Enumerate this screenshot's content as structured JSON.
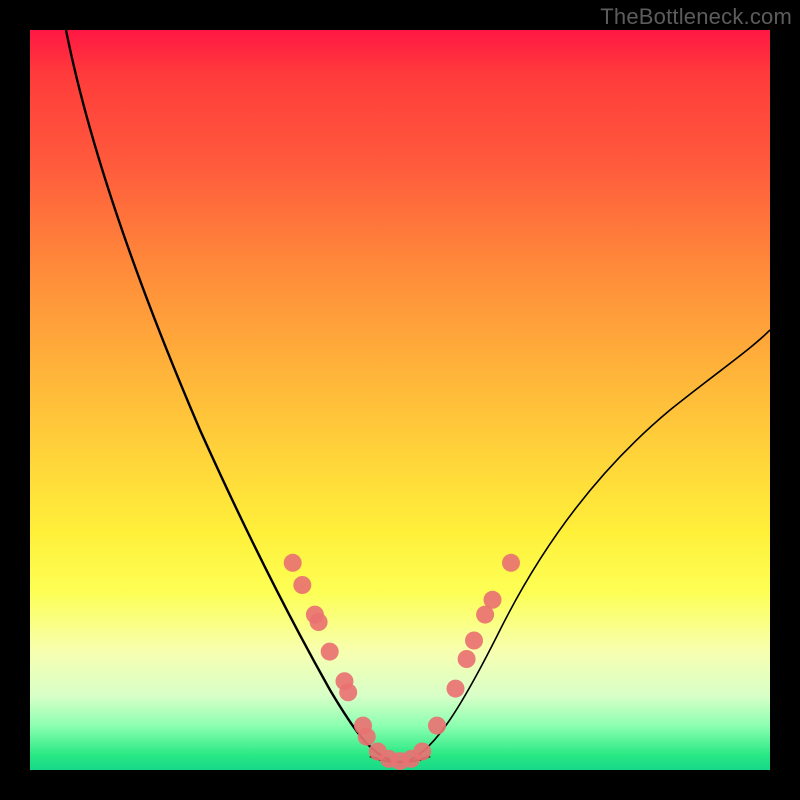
{
  "watermark": "TheBottleneck.com",
  "chart_data": {
    "type": "line",
    "title": "",
    "xlabel": "",
    "ylabel": "",
    "xlim": [
      0,
      100
    ],
    "ylim": [
      0,
      100
    ],
    "grid": false,
    "legend": false,
    "background_gradient": {
      "top": "#ff1744",
      "mid": "#ffd53a",
      "bottom": "#17d888"
    },
    "series": [
      {
        "name": "left-branch",
        "x": [
          4,
          8,
          12,
          16,
          20,
          24,
          28,
          32,
          34,
          36,
          38,
          40,
          42,
          44,
          46,
          48
        ],
        "values": [
          100,
          93,
          85,
          76,
          67,
          58,
          49,
          39,
          34,
          29,
          24,
          19,
          14,
          9,
          5,
          2
        ]
      },
      {
        "name": "right-branch",
        "x": [
          52,
          54,
          56,
          58,
          60,
          64,
          68,
          72,
          76,
          80,
          84,
          88,
          92,
          96,
          100
        ],
        "values": [
          2,
          5,
          9,
          13,
          17,
          24,
          30,
          36,
          41,
          46,
          50,
          53,
          56,
          58,
          60
        ]
      },
      {
        "name": "valley-floor",
        "x": [
          44,
          46,
          48,
          50,
          52,
          54
        ],
        "values": [
          4,
          2,
          1,
          1,
          2,
          4
        ]
      }
    ],
    "data_points": [
      {
        "x": 35.5,
        "y": 28
      },
      {
        "x": 36.8,
        "y": 25
      },
      {
        "x": 38.5,
        "y": 21
      },
      {
        "x": 39.0,
        "y": 20
      },
      {
        "x": 40.5,
        "y": 16
      },
      {
        "x": 42.5,
        "y": 12
      },
      {
        "x": 43.0,
        "y": 10.5
      },
      {
        "x": 45.0,
        "y": 6
      },
      {
        "x": 45.5,
        "y": 4.5
      },
      {
        "x": 47.0,
        "y": 2.5
      },
      {
        "x": 48.5,
        "y": 1.5
      },
      {
        "x": 50.0,
        "y": 1.2
      },
      {
        "x": 51.5,
        "y": 1.5
      },
      {
        "x": 53.0,
        "y": 2.5
      },
      {
        "x": 55.0,
        "y": 6
      },
      {
        "x": 57.5,
        "y": 11
      },
      {
        "x": 59.0,
        "y": 15
      },
      {
        "x": 60.0,
        "y": 17.5
      },
      {
        "x": 61.5,
        "y": 21
      },
      {
        "x": 62.5,
        "y": 23
      },
      {
        "x": 65.0,
        "y": 28
      }
    ],
    "dot_color": "#e97272",
    "dot_radius_px": 9
  }
}
